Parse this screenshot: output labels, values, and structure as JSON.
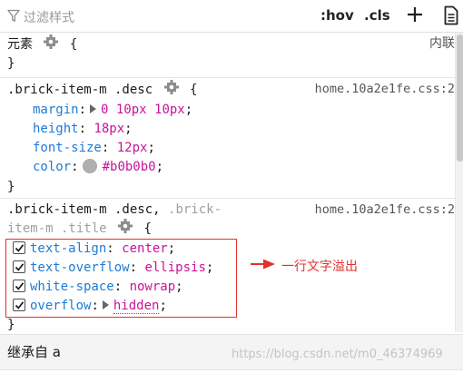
{
  "toolbar": {
    "filter_placeholder": "过滤样式",
    "hov_label": ":hov",
    "cls_label": ".cls"
  },
  "rules": {
    "element": {
      "selector": "元素",
      "source": "内联"
    },
    "desc": {
      "selector": ".brick-item-m .desc",
      "source": "home.10a2e1fe.css:2",
      "decls": [
        {
          "prop": "margin",
          "value": "0 10px 10px"
        },
        {
          "prop": "height",
          "value": "18px"
        },
        {
          "prop": "font-size",
          "value": "12px"
        },
        {
          "prop": "color",
          "value": "#b0b0b0",
          "swatch": "#b0b0b0"
        }
      ]
    },
    "title": {
      "selector_line1_active": ".brick-item-m .desc,",
      "selector_line1_dim": ".brick-",
      "selector_line2_dim": "item-m .title",
      "source": "home.10a2e1fe.css:2",
      "decls": [
        {
          "prop": "text-align",
          "value": "center"
        },
        {
          "prop": "text-overflow",
          "value": "ellipsis"
        },
        {
          "prop": "white-space",
          "value": "nowrap"
        },
        {
          "prop": "overflow",
          "value": "hidden"
        }
      ]
    }
  },
  "annotation": {
    "text": "一行文字溢出",
    "color": "#e0322d"
  },
  "inherit": {
    "label": "继承自 a"
  },
  "watermark": "https://blog.csdn.net/m0_46374969",
  "colors": {
    "property": "#1e7bd6",
    "value": "#c8139a",
    "highlight": "#e0322d"
  }
}
